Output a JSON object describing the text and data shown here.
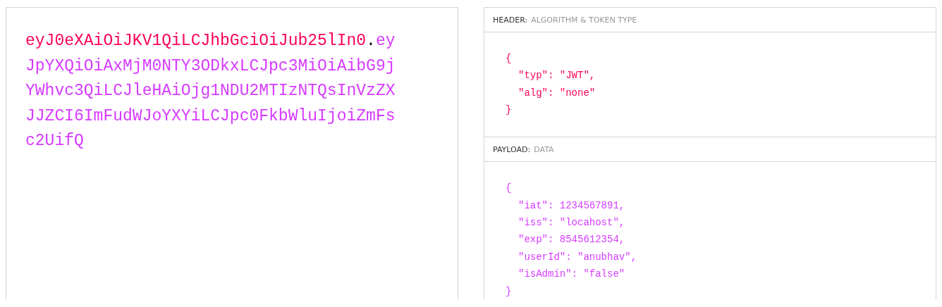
{
  "encoded_lines": [
    [
      {
        "kind": "header",
        "text": "eyJ0eXAiOiJKV1QiLCJhbGciOiJub25lIn0"
      },
      {
        "kind": "dot",
        "text": "."
      },
      {
        "kind": "payload",
        "text": "ey"
      }
    ],
    [
      {
        "kind": "payload",
        "text": "JpYXQiOiAxMjM0NTY3ODkxLCJpc3MiOiAibG9j"
      }
    ],
    [
      {
        "kind": "payload",
        "text": "YWhvc3QiLCJleHAiOjg1NDU2MTIzNTQsInVzZX"
      }
    ],
    [
      {
        "kind": "payload",
        "text": "JJZCI6ImFudWJoYXYiLCJpc0FkbWluIjoiZmFs"
      }
    ],
    [
      {
        "kind": "payload",
        "text": "c2UifQ"
      }
    ]
  ],
  "sections": [
    {
      "kind": "header",
      "title": "HEADER:",
      "subtitle": "ALGORITHM & TOKEN TYPE",
      "lines": [
        {
          "kind": "brace",
          "text": "{"
        },
        {
          "kind": "entry",
          "text": "\"typ\": \"JWT\","
        },
        {
          "kind": "entry",
          "text": "\"alg\": \"none\""
        },
        {
          "kind": "brace",
          "text": "}"
        }
      ]
    },
    {
      "kind": "payload",
      "title": "PAYLOAD:",
      "subtitle": "DATA",
      "lines": [
        {
          "kind": "brace",
          "text": "{"
        },
        {
          "kind": "entry",
          "text": "\"iat\": 1234567891,"
        },
        {
          "kind": "entry",
          "text": "\"iss\": \"locahost\","
        },
        {
          "kind": "entry",
          "text": "\"exp\": 8545612354,"
        },
        {
          "kind": "entry",
          "text": "\"userId\": \"anubhav\","
        },
        {
          "kind": "entry",
          "text": "\"isAdmin\": \"false\""
        },
        {
          "kind": "brace",
          "text": "}"
        }
      ]
    }
  ]
}
